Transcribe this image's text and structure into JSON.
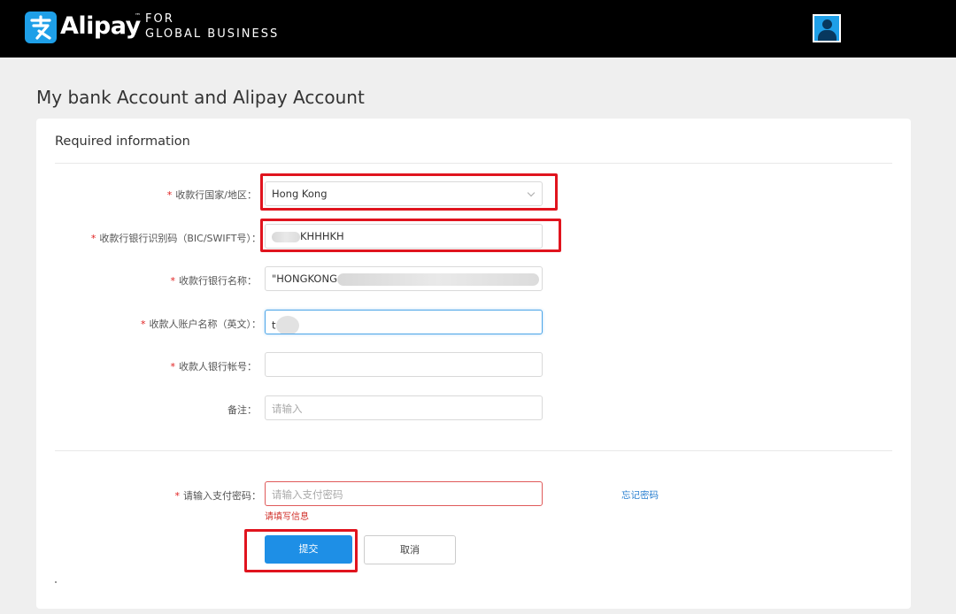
{
  "header": {
    "logo_text": "Alipay",
    "logo_tm": "™",
    "logo_sub_line1": "FOR",
    "logo_sub_line2": "GLOBAL BUSINESS",
    "brand_color": "#1e9fe8",
    "avatar_icon": "user-avatar-icon"
  },
  "page": {
    "title": "My bank Account and Alipay Account"
  },
  "form": {
    "section_title": "Required information",
    "required_mark": "*",
    "fields": {
      "country": {
        "label": "收款行国家/地区：",
        "value": "Hong Kong"
      },
      "swift": {
        "label": "收款行银行识别码（BIC/SWIFT号）：",
        "value": "KHHHKH"
      },
      "bank_name": {
        "label": "收款行银行名称：",
        "value": "\"HONGKONG"
      },
      "account_name": {
        "label": "收款人账户名称（英文）：",
        "value": "t"
      },
      "account_number": {
        "label": "收款人银行帐号：",
        "value": ""
      },
      "remarks": {
        "label": "备注：",
        "placeholder": "请输入"
      },
      "password": {
        "label": "请输入支付密码：",
        "placeholder": "请输入支付密码",
        "error": "请填写信息"
      }
    },
    "forgot_password": "忘记密码",
    "submit": "提交",
    "cancel": "取消"
  },
  "colors": {
    "highlight": "#e0141e",
    "primary_button": "#1e8fe6",
    "error": "#d0302a",
    "link": "#2a7fd0"
  }
}
